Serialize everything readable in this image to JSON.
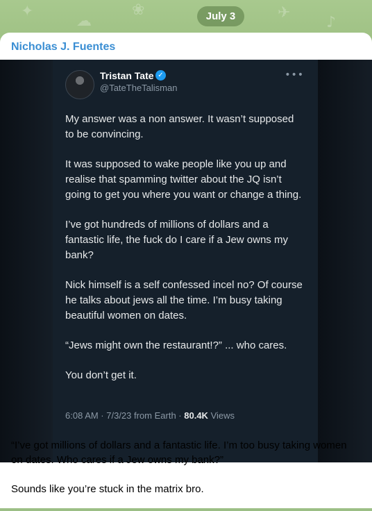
{
  "header": {
    "date_label": "July 3"
  },
  "message": {
    "sender_name": "Nicholas J. Fuentes",
    "caption_lines": [
      "“I’ve got millions of dollars and a fantastic life. I’m too busy taking women on dates. Who cares if a Jew owns my bank?”",
      "Sounds like you’re stuck in the matrix bro."
    ]
  },
  "tweet": {
    "author_name": "Tristan Tate",
    "handle": "@TateTheTalisman",
    "verified_icon": "verified-check-icon",
    "more_icon": "more-options-icon",
    "paragraphs": [
      "My answer was a non answer. It wasn’t supposed to be convincing.",
      "It was supposed to wake people like you up and realise that spamming twitter about the JQ isn’t going to get you where you want or change a thing.",
      "I’ve got hundreds of millions of dollars and a fantastic life, the fuck do I care if a Jew owns my bank?",
      "Nick himself is a self confessed incel no? Of course he talks about jews all the time. I’m busy taking beautiful women on dates.",
      "“Jews might own the restaurant!?” ... who cares.",
      "You don’t get it."
    ],
    "meta_prefix": "6:08 AM · 7/3/23 from Earth · ",
    "views_count": "80.4K",
    "views_label": " Views"
  },
  "colors": {
    "chat_background": "#9cbf86",
    "sender_name": "#3a8ed3",
    "tweet_background": "#15202b",
    "verified_badge": "#1d9bf0"
  }
}
